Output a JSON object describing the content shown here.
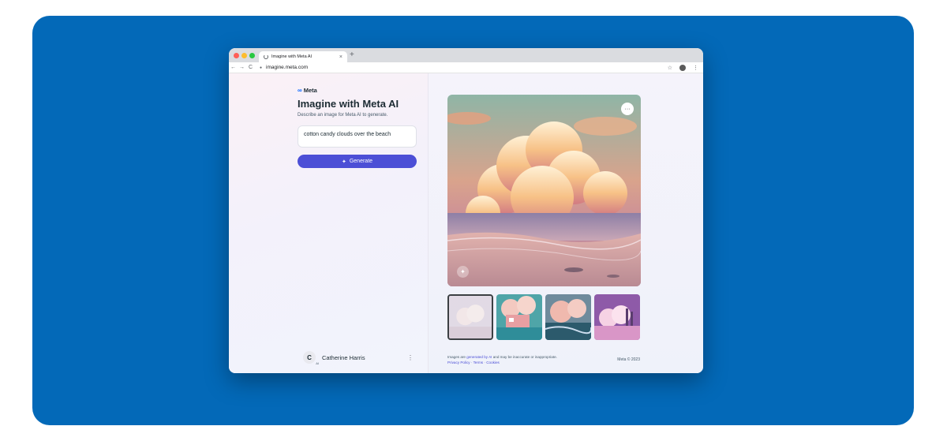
{
  "browser": {
    "tab_title": "Imagine with Meta AI",
    "tab_close": "×",
    "new_tab": "+",
    "url": "imagine.meta.com",
    "nav_back": "←",
    "nav_forward": "→",
    "nav_reload": "C",
    "star": "☆",
    "menu": "⋮",
    "lock_icon": "lock-icon"
  },
  "brand": {
    "name": "Meta",
    "logo": "∞"
  },
  "hero": {
    "title": "Imagine with Meta AI",
    "subtitle": "Describe an image for Meta AI to generate."
  },
  "prompt": {
    "value": "cotton candy clouds over the beach"
  },
  "generate": {
    "icon": "✦",
    "label": "Generate"
  },
  "user": {
    "initial": "C",
    "ai_badge": "AI",
    "name": "Catherine Harris",
    "menu": "⋮"
  },
  "image": {
    "options": "···",
    "animate_icon": "✦"
  },
  "footer": {
    "note_pre": "Images are ",
    "note_link": "generated by AI",
    "note_post": " and may be inaccurate or inappropriate.",
    "privacy": "Privacy Policy",
    "sep": " · ",
    "terms": "Terms",
    "cookies": "Cookies",
    "copyright": "Meta © 2023"
  },
  "colors": {
    "stage": "#0369b8",
    "generate": "#4c4fd6",
    "link": "#4c4fd6"
  }
}
